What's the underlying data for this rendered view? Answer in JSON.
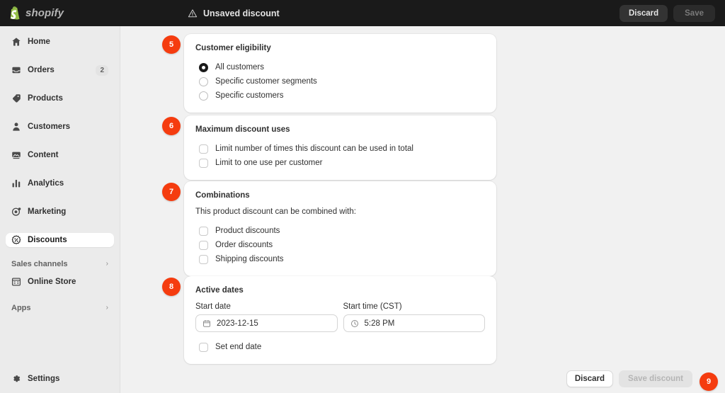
{
  "topbar": {
    "brand": "shopify",
    "brand_icon": "shopify-bag-icon",
    "warning_icon": "warning-triangle-icon",
    "title": "Unsaved discount",
    "discard_label": "Discard",
    "save_label": "Save",
    "background": "#1a1a1a"
  },
  "sidebar": {
    "items": [
      {
        "label": "Home",
        "icon": "home-icon",
        "badge": "",
        "active": false
      },
      {
        "label": "Orders",
        "icon": "orders-icon",
        "badge": "2",
        "active": false
      },
      {
        "label": "Products",
        "icon": "products-tag-icon",
        "badge": "",
        "active": false
      },
      {
        "label": "Customers",
        "icon": "customers-person-icon",
        "badge": "",
        "active": false
      },
      {
        "label": "Content",
        "icon": "content-image-icon",
        "badge": "",
        "active": false
      },
      {
        "label": "Analytics",
        "icon": "analytics-bar-chart-icon",
        "badge": "",
        "active": false
      },
      {
        "label": "Marketing",
        "icon": "marketing-target-icon",
        "badge": "",
        "active": false
      },
      {
        "label": "Discounts",
        "icon": "discounts-seal-icon",
        "badge": "",
        "active": true
      }
    ],
    "sales_channels": {
      "label": "Sales channels",
      "chevron_icon": "chevron-right-icon"
    },
    "online_store": {
      "label": "Online Store",
      "icon": "online-store-icon"
    },
    "apps": {
      "label": "Apps",
      "chevron_icon": "chevron-right-icon"
    },
    "settings": {
      "label": "Settings",
      "icon": "gear-icon"
    }
  },
  "cards": {
    "customer_eligibility": {
      "step": "5",
      "title": "Customer eligibility",
      "options": [
        {
          "label": "All customers",
          "checked": true
        },
        {
          "label": "Specific customer segments",
          "checked": false
        },
        {
          "label": "Specific customers",
          "checked": false
        }
      ]
    },
    "maximum_discount_uses": {
      "step": "6",
      "title": "Maximum discount uses",
      "options": [
        {
          "label": "Limit number of times this discount can be used in total",
          "checked": false
        },
        {
          "label": "Limit to one use per customer",
          "checked": false
        }
      ]
    },
    "combinations": {
      "step": "7",
      "title": "Combinations",
      "subtitle": "This product discount can be combined with:",
      "options": [
        {
          "label": "Product discounts",
          "checked": false
        },
        {
          "label": "Order discounts",
          "checked": false
        },
        {
          "label": "Shipping discounts",
          "checked": false
        }
      ]
    },
    "active_dates": {
      "step": "8",
      "title": "Active dates",
      "start_date": {
        "label": "Start date",
        "value": "2023-12-15",
        "icon": "calendar-icon"
      },
      "start_time": {
        "label": "Start time (CST)",
        "value": "5:28 PM",
        "icon": "clock-icon"
      },
      "set_end_date": {
        "label": "Set end date",
        "checked": false
      }
    }
  },
  "bottom_bar": {
    "discard_label": "Discard",
    "save_label": "Save discount",
    "step": "9"
  },
  "colors": {
    "accent_badge": "#f53c0f",
    "page_background": "#f1f1f1",
    "sidebar_background": "#ebebeb",
    "topbar_background": "#1a1a1a",
    "text_primary": "#303030"
  }
}
